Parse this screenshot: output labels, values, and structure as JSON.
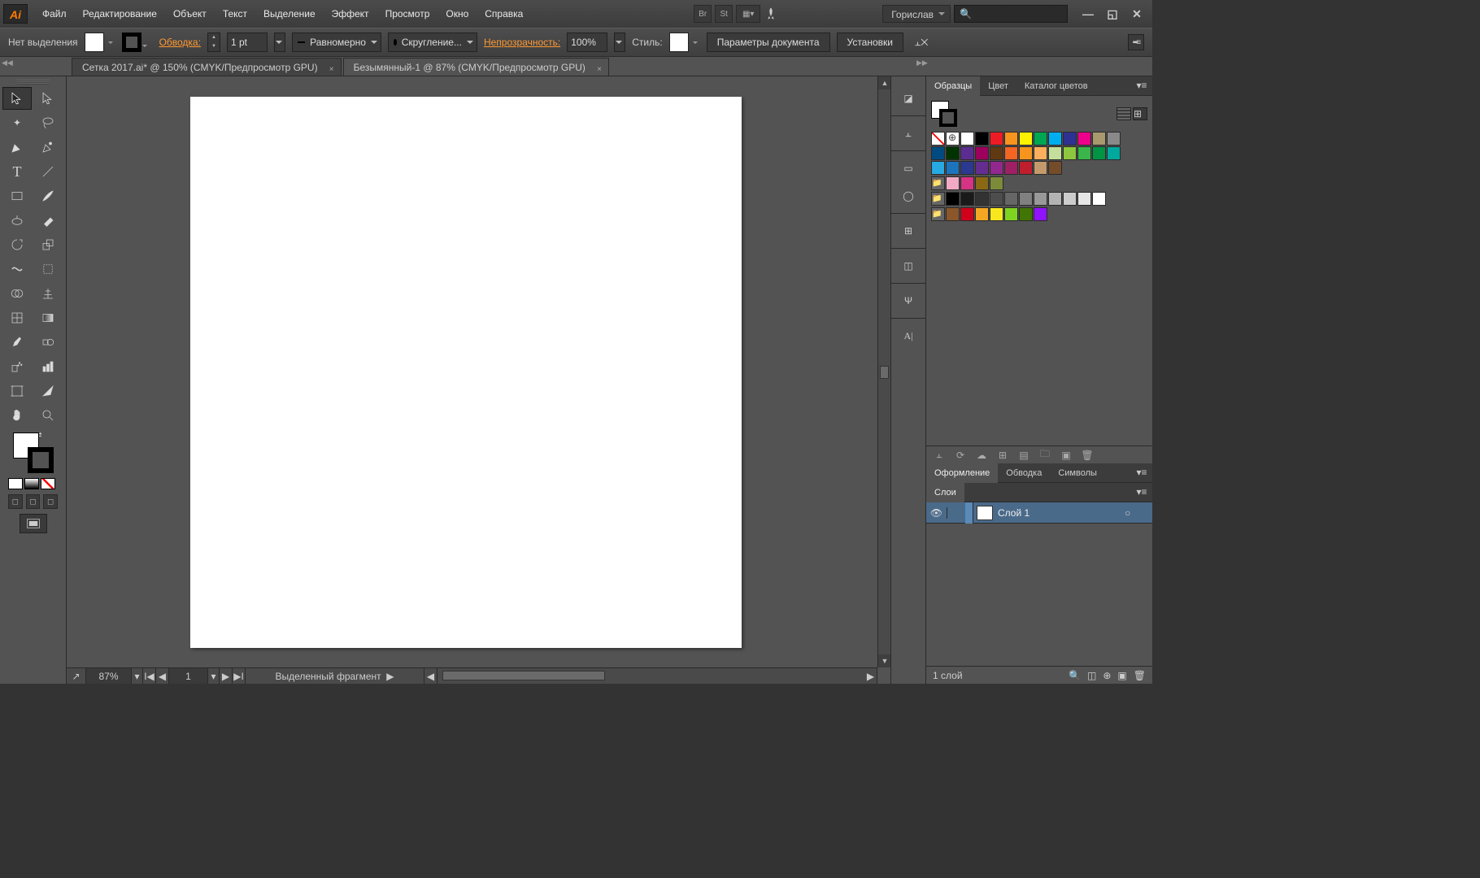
{
  "menubar": {
    "logo": "Ai",
    "items": [
      "Файл",
      "Редактирование",
      "Объект",
      "Текст",
      "Выделение",
      "Эффект",
      "Просмотр",
      "Окно",
      "Справка"
    ],
    "bridge_label": "Br",
    "stock_label": "St",
    "workspace": "Горислав",
    "search_placeholder": "🔍"
  },
  "controlbar": {
    "no_selection": "Нет выделения",
    "stroke_label": "Обводка:",
    "stroke_weight": "1 pt",
    "stroke_profile": "Равномерно",
    "cap_label": "Скругление...",
    "opacity_label": "Непрозрачность:",
    "opacity_value": "100%",
    "style_label": "Стиль:",
    "doc_setup": "Параметры документа",
    "prefs": "Установки"
  },
  "tabs": [
    {
      "title": "Сетка 2017.ai* @ 150% (CMYK/Предпросмотр GPU)",
      "active": false
    },
    {
      "title": "Безымянный-1 @ 87% (CMYK/Предпросмотр GPU)",
      "active": true
    }
  ],
  "statusbar": {
    "zoom": "87%",
    "page": "1",
    "info": "Выделенный фрагмент"
  },
  "panels": {
    "swatches_tabs": [
      "Образцы",
      "Цвет",
      "Каталог цветов"
    ],
    "swatch_colors_row1": [
      "none",
      "reg",
      "#ffffff",
      "#000000",
      "#ed1c24",
      "#f7941d",
      "#fff200",
      "#00a651",
      "#00aeef",
      "#2e3192",
      "#ec008c",
      "#a8996e",
      "#898989",
      "#004a80",
      "#003300",
      "#5c2d91",
      "#9e005d",
      "#603913",
      "#f26522",
      "#f7941d",
      "#fbaf5d"
    ],
    "swatch_colors_row2": [
      "#c4df9b",
      "#8dc63f",
      "#39b54a",
      "#009444",
      "#00a99d",
      "#27aae1",
      "#1c75bc",
      "#2b3990",
      "#662d91",
      "#92278f",
      "#9e1f63",
      "#be1e2d",
      "#c49a6c",
      "#754c29"
    ],
    "swatch_colors_row3": [
      "#f1a9c4",
      "#d63384",
      "#8b6914",
      "#7b8b3a"
    ],
    "swatch_colors_row4": [
      "#000000",
      "#1a1a1a",
      "#333333",
      "#4d4d4d",
      "#666666",
      "#808080",
      "#999999",
      "#b3b3b3",
      "#cccccc",
      "#e6e6e6",
      "#ffffff"
    ],
    "swatch_colors_row5": [
      "#8b572a",
      "#d0021b",
      "#f5a623",
      "#f8e71c",
      "#7ed321",
      "#417505",
      "#9013fe"
    ],
    "appearance_tabs": [
      "Оформление",
      "Обводка",
      "Символы"
    ],
    "layers_tab": "Слои",
    "layers": [
      {
        "name": "Слой 1"
      }
    ],
    "layers_count": "1 слой"
  }
}
